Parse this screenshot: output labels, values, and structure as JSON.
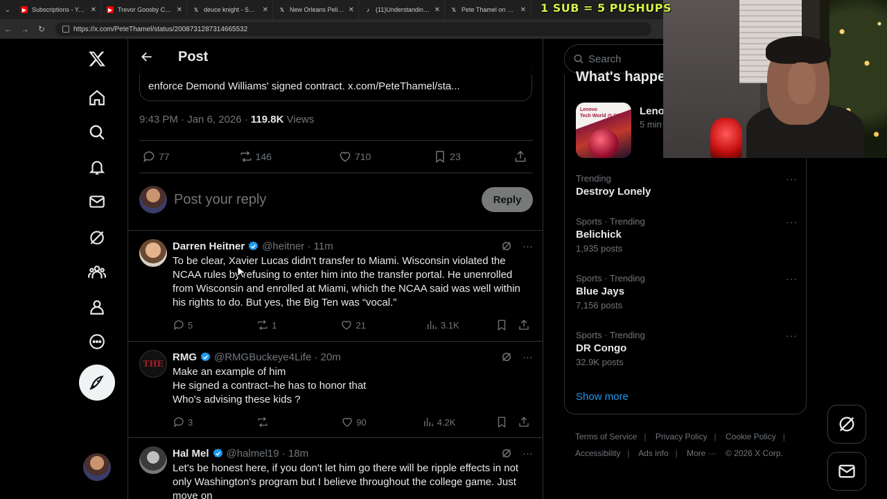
{
  "browser": {
    "tabs": [
      {
        "title": "Subscriptions - YouTube",
        "color": "#ff0000",
        "icon": "youtube-icon"
      },
      {
        "title": "Trevor Goosby College",
        "color": "#ff0000",
        "icon": "youtube-icon"
      },
      {
        "title": "deuce knight - Search",
        "color": "#000000",
        "icon": "x-icon"
      },
      {
        "title": "New Orleans Pelicans",
        "color": "#000000",
        "icon": "x-icon"
      },
      {
        "title": "(11)Understanding th",
        "color": "#000000",
        "icon": "tiktok-icon"
      },
      {
        "title": "Pete Thamel on X: \"W",
        "color": "#000000",
        "icon": "x-icon"
      }
    ],
    "url": "https://x.com/PeteThamel/status/2008731287314665532"
  },
  "overlay": {
    "banner": "1 SUB = 5 PUSHUPS"
  },
  "header": {
    "title": "Post"
  },
  "post": {
    "quote_text": "enforce Demond Williams' signed contract. x.com/PeteThamel/sta...",
    "time": "9:43 PM · Jan 6, 2026 · ",
    "views_count": "119.8K",
    "views_label": " Views",
    "replies": "77",
    "reposts": "146",
    "likes": "710",
    "bookmarks": "23"
  },
  "reply_box": {
    "placeholder": "Post your reply",
    "button": "Reply"
  },
  "replies": [
    {
      "name": "Darren Heitner",
      "handle": "@heitner · 11m",
      "text": "To be clear, Xavier Lucas didn't transfer to Miami. Wisconsin violated the NCAA rules by refusing to enter him into the transfer portal. He unenrolled from Wisconsin and enrolled at Miami, which the NCAA said was well within his rights to do. But yes, the Big Ten was “vocal.”",
      "replies": "5",
      "reposts": "1",
      "likes": "21",
      "views": "3.1K"
    },
    {
      "name": "RMG",
      "handle": "@RMGBuckeye4Life · 20m",
      "text": "Make an example of him\nHe signed a contract–he has to honor that\nWho's advising these kids ?",
      "replies": "3",
      "reposts": "",
      "likes": "90",
      "views": "4.2K"
    },
    {
      "name": "Hal Mel",
      "handle": "@halmel19 · 18m",
      "text": "Let's be honest here, if you don't let him go there will be ripple effects in not only Washington's program but I believe throughout the college game. Just move on",
      "replies": "",
      "reposts": "",
      "likes": "",
      "views": ""
    }
  ],
  "sidebar": {
    "search_placeholder": "Search",
    "whats_happening": "What's happe",
    "promo": {
      "title": "Leno",
      "sub": "5 min",
      "img_text": "Lenovo\nTech World @ CES"
    },
    "trends": [
      {
        "category": "Trending",
        "name": "Destroy Lonely",
        "count": ""
      },
      {
        "category": "Sports · Trending",
        "name": "Belichick",
        "count": "1,935 posts"
      },
      {
        "category": "Sports · Trending",
        "name": "Blue Jays",
        "count": "7,156 posts"
      },
      {
        "category": "Sports · Trending",
        "name": "DR Congo",
        "count": "32.9K posts"
      }
    ],
    "show_more": "Show more",
    "footer": [
      "Terms of Service",
      "Privacy Policy",
      "Cookie Policy",
      "Accessibility",
      "Ads info",
      "More ···",
      "© 2026 X Corp."
    ]
  },
  "colors": {
    "accent": "#1d9bf0",
    "muted": "#71767b",
    "border": "#2f3336"
  }
}
